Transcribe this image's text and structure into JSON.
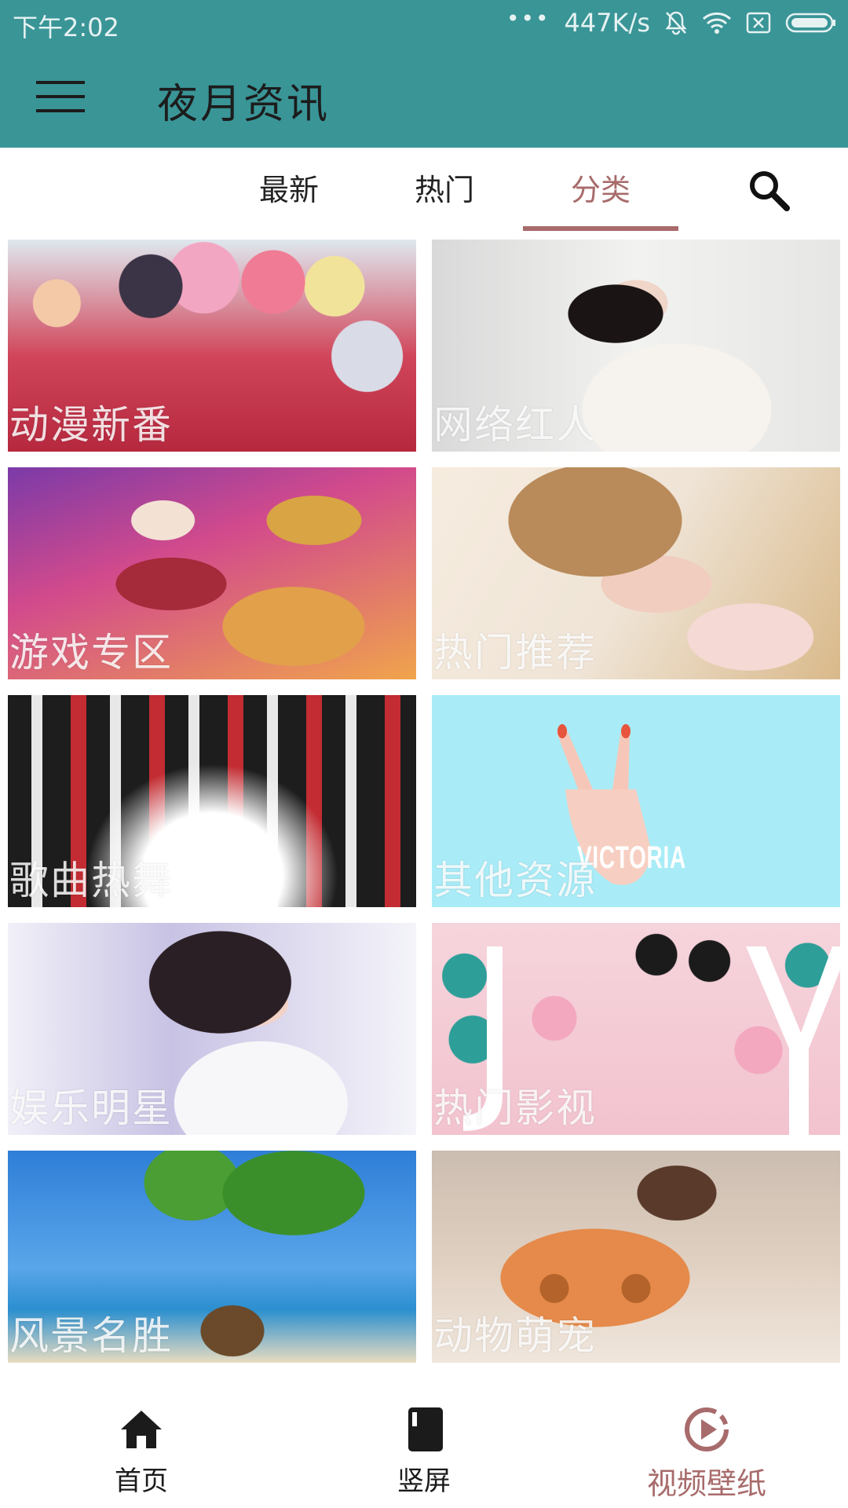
{
  "status_bar": {
    "time": "下午2:02",
    "dots": "•••",
    "speed": "447K/s"
  },
  "app_bar": {
    "title": "夜月资讯"
  },
  "tabs": [
    {
      "label": "最新"
    },
    {
      "label": "热门"
    },
    {
      "label": "分类"
    }
  ],
  "active_tab": "分类",
  "categories": [
    {
      "label": "动漫新番"
    },
    {
      "label": "网络红人"
    },
    {
      "label": "游戏专区"
    },
    {
      "label": "热门推荐"
    },
    {
      "label": "歌曲热舞"
    },
    {
      "label": "其他资源"
    },
    {
      "label": "娱乐明星"
    },
    {
      "label": "热门影视"
    },
    {
      "label": "风景名胜"
    },
    {
      "label": "动物萌宠"
    }
  ],
  "image_text": {
    "victoria": "VICTORIA"
  },
  "bottom_nav": [
    {
      "label": "首页",
      "icon": "home-icon"
    },
    {
      "label": "竖屏",
      "icon": "book-icon"
    },
    {
      "label": "视频壁纸",
      "icon": "play-circle-icon"
    }
  ],
  "colors": {
    "primary": "#3a9597",
    "accent": "#a86b6b"
  }
}
